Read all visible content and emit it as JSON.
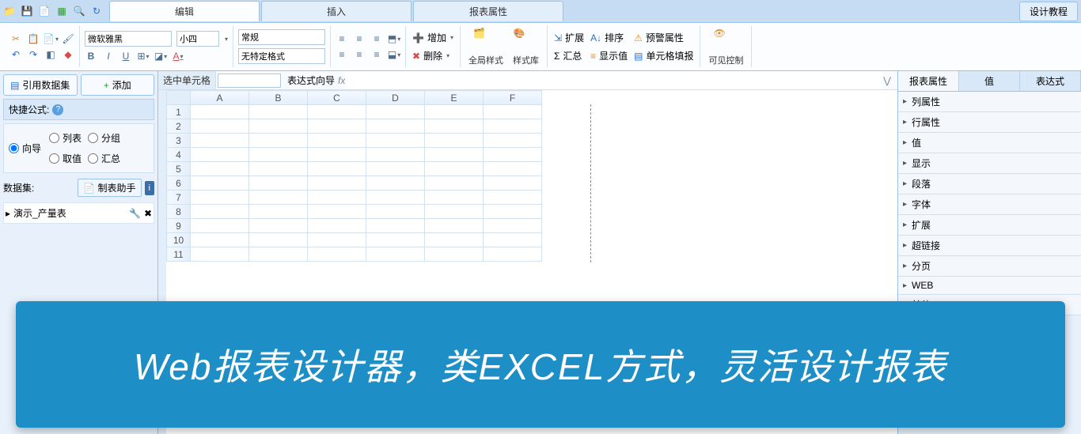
{
  "titlebar": {
    "design_tutorial": "设计教程"
  },
  "tabs": {
    "edit": "编辑",
    "insert": "插入",
    "report_props": "报表属性"
  },
  "ribbon": {
    "font_family": "微软雅黑",
    "font_size": "小四",
    "format_category": "常规",
    "format_style": "无特定格式",
    "bold": "B",
    "italic": "I",
    "underline": "U",
    "add": "增加",
    "delete": "删除",
    "global_style": "全局样式",
    "style_lib": "样式库",
    "expand": "扩展",
    "summary": "汇总",
    "sort": "排序",
    "show_value": "显示值",
    "alert_props": "预警属性",
    "cell_fill": "单元格填报",
    "visible_ctrl": "可见控制"
  },
  "formula": {
    "selected_cell": "选中单元格",
    "expr_wizard": "表达式向导"
  },
  "left": {
    "ref_dataset": "引用数据集",
    "add": "添加",
    "quick_formula": "快捷公式:",
    "wizard": "向导",
    "list": "列表",
    "group": "分组",
    "value": "取值",
    "summary": "汇总",
    "datasets_label": "数据集:",
    "table_helper": "制表助手",
    "dataset_name": "演示_产量表"
  },
  "grid": {
    "cols": [
      "A",
      "B",
      "C",
      "D",
      "E",
      "F"
    ],
    "rows": [
      "1",
      "2",
      "3",
      "4",
      "5",
      "6",
      "7",
      "8",
      "9",
      "10",
      "11"
    ]
  },
  "right": {
    "tabs": {
      "props": "报表属性",
      "value": "值",
      "expr": "表达式"
    },
    "items": [
      "列属性",
      "行属性",
      "值",
      "显示",
      "段落",
      "字体",
      "扩展",
      "超链接",
      "分页",
      "WEB",
      "其他"
    ]
  },
  "banner": "Web报表设计器，类EXCEL方式，灵活设计报表"
}
